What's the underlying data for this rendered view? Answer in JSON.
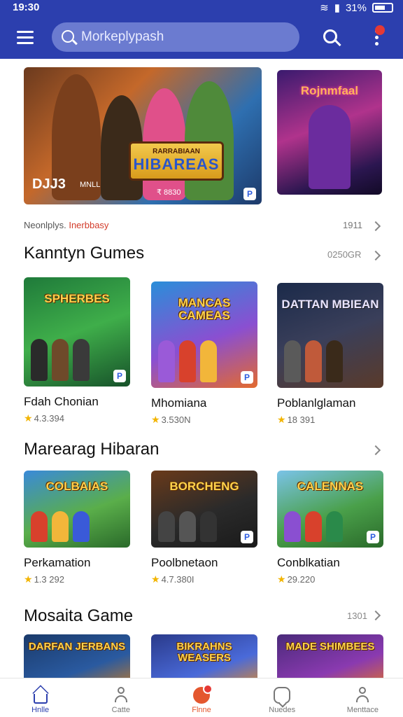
{
  "status": {
    "time": "19:30",
    "battery": "31%"
  },
  "header": {
    "search_placeholder": "Morkeplypash",
    "menu_icon": "menu-icon",
    "search_icon": "search-icon",
    "more_icon": "more-vert-icon"
  },
  "hero": {
    "main": {
      "subtitle": "RARRABIAAN",
      "title": "HIBAREAS",
      "badge_left": "DJJ3",
      "badge_left2": "MNLL",
      "badge_right": "₹ 8830"
    },
    "side": {
      "title": "Rojnmfaal"
    }
  },
  "info_row": {
    "left": "Neonlplys.",
    "accent": "Inerbbasy",
    "right": "1911"
  },
  "sections": [
    {
      "title": "Kanntyn Gumes",
      "count": "0250GR",
      "cards": [
        {
          "thumb_title": "SPHERBES",
          "name": "Fdah Chonian",
          "rating": "4.3.394"
        },
        {
          "thumb_title": "MANCAS CAMEAS",
          "name": "Mhomiana",
          "rating": "3.530N"
        },
        {
          "thumb_title": "DATTAN MBIEAN",
          "name": "Poblanlglaman",
          "rating": "18 391"
        }
      ]
    },
    {
      "title": "Marearag Hibaran",
      "count": "",
      "cards": [
        {
          "thumb_title": "COLBAIAS",
          "name": "Perkamation",
          "rating": "1.3 292"
        },
        {
          "thumb_title": "BORCHENG",
          "name": "Poolbnetaon",
          "rating": "4.7.380I"
        },
        {
          "thumb_title": "CALENNAS",
          "name": "Conblkatian",
          "rating": "29.220"
        }
      ]
    },
    {
      "title": "Mosaita Game",
      "count": "1301",
      "cards": [
        {
          "thumb_title": "DARFAN JERBANS"
        },
        {
          "thumb_title": "BIKRAHNS WEASERS"
        },
        {
          "thumb_title": "MADE SHIMBEES"
        }
      ]
    }
  ],
  "nav": [
    {
      "label": "Hnlle",
      "icon": "home-icon"
    },
    {
      "label": "Catte",
      "icon": "user-icon"
    },
    {
      "label": "Flnne",
      "icon": "flame-icon"
    },
    {
      "label": "Nuedes",
      "icon": "chat-icon"
    },
    {
      "label": "Menttace",
      "icon": "person-icon"
    }
  ],
  "colors": {
    "primary": "#2c3fae",
    "accent": "#d33b2a",
    "star": "#f2b400"
  }
}
